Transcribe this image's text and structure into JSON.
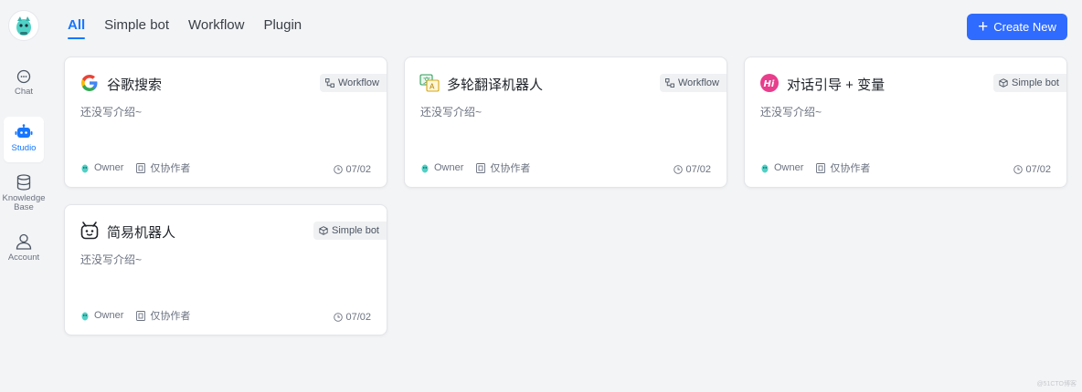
{
  "nav": {
    "chat": "Chat",
    "studio": "Studio",
    "knowledge": "Knowledge Base",
    "account": "Account"
  },
  "tabs": [
    "All",
    "Simple bot",
    "Workflow",
    "Plugin"
  ],
  "create_label": "Create New",
  "cards": [
    {
      "title": "谷歌搜索",
      "badge": "Workflow",
      "desc": "还没写介绍~",
      "owner": "Owner",
      "perm": "仅协作者",
      "date": "07/02",
      "icon": "google-icon"
    },
    {
      "title": "多轮翻译机器人",
      "badge": "Workflow",
      "desc": "还没写介绍~",
      "owner": "Owner",
      "perm": "仅协作者",
      "date": "07/02",
      "icon": "translate-icon"
    },
    {
      "title": "对话引导 + 变量",
      "badge": "Simple bot",
      "desc": "还没写介绍~",
      "owner": "Owner",
      "perm": "仅协作者",
      "date": "07/02",
      "icon": "hi-icon"
    },
    {
      "title": "简易机器人",
      "badge": "Simple bot",
      "desc": "还没写介绍~",
      "owner": "Owner",
      "perm": "仅协作者",
      "date": "07/02",
      "icon": "robot-face-icon"
    }
  ],
  "watermark": "@51CTO博客",
  "colors": {
    "accent": "#1677ff",
    "button": "#2f6bff",
    "background": "#f3f4f6"
  }
}
